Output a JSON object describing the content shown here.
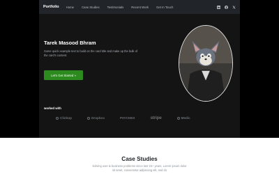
{
  "nav": {
    "brand": "Portfolio",
    "links": [
      "Home",
      "Case Studies",
      "Testimonials",
      "Recent Work",
      "Get In Touch"
    ],
    "socials": [
      "linkedin-icon",
      "facebook-icon",
      "x-icon"
    ]
  },
  "hero": {
    "name": "Tarek Masood Bhram",
    "lead": "Some quick example text to build on the card title and make up the bulk of the card's content.",
    "cta": "Let's Get Started »",
    "avatar": "cartoon-cat-portrait"
  },
  "worked_with": {
    "label": "worked with",
    "logos": [
      "ClickUp",
      "Dropbox",
      "PAYCHEX",
      "stripe",
      "Medic"
    ]
  },
  "case_studies": {
    "title": "Case Studies",
    "description": "Solving user & business problems since last 15+ years. Lorem ipsum dolor sit amet, consectetur adipiscing elit, sed do"
  },
  "colors": {
    "page_background": "#000000",
    "navbar": "#212529",
    "hero_background": "#141414",
    "cta_green": "#2d8a1f"
  }
}
